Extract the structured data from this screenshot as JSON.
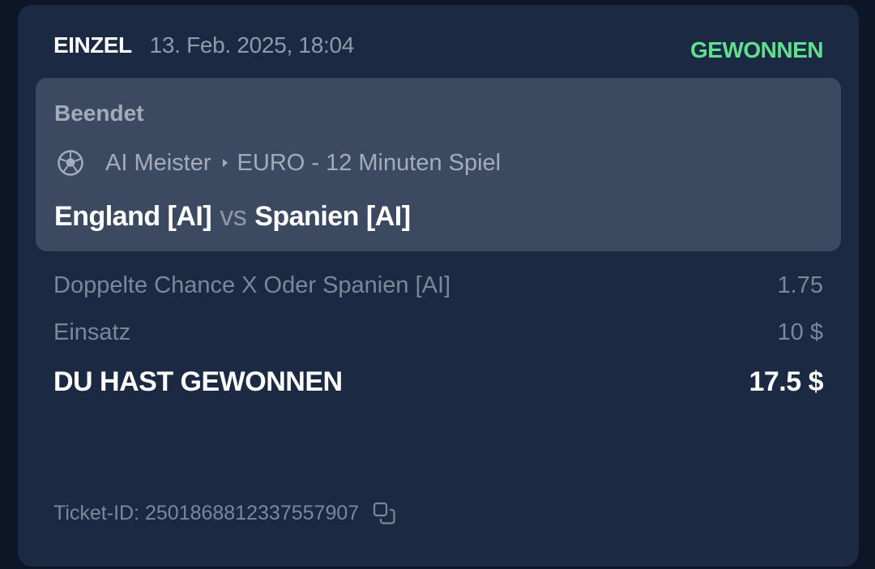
{
  "header": {
    "bet_type": "EINZEL",
    "date": "13. Feb. 2025, 18:04",
    "status": "GEWONNEN",
    "status_color": "#5fe08e"
  },
  "event": {
    "state": "Beendet",
    "sport_icon": "soccer-ball-icon",
    "league": "AI Meister",
    "competition": "EURO - 12 Minuten Spiel",
    "home_team": "England [AI]",
    "vs": "vs",
    "away_team": "Spanien [AI]"
  },
  "bet": {
    "selection": "Doppelte Chance X Oder Spanien [AI]",
    "odds": "1.75",
    "stake_label": "Einsatz",
    "stake_value": "10 $",
    "payout_label": "DU HAST GEWONNEN",
    "payout_value": "17.5 $"
  },
  "ticket": {
    "label": "Ticket-ID:",
    "id": "2501868812337557907",
    "copy_icon": "copy-icon"
  }
}
